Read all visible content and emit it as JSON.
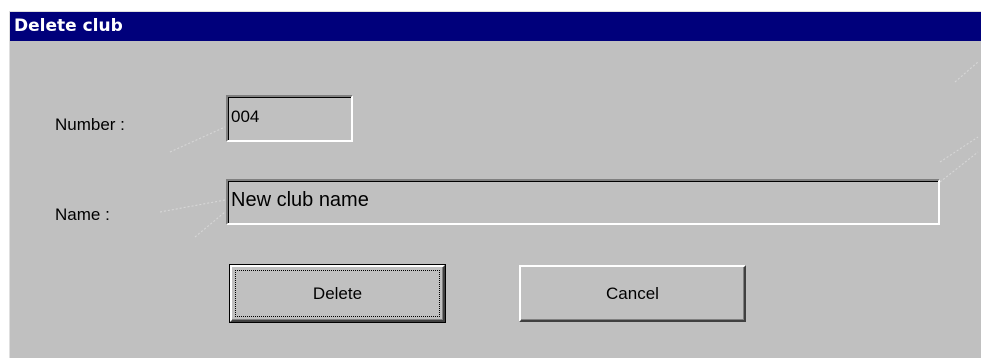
{
  "window": {
    "title": "Delete club"
  },
  "form": {
    "number_label": "Number :",
    "number_value": "004",
    "name_label": "Name :",
    "name_value": "New club name"
  },
  "buttons": {
    "delete_label": "Delete",
    "cancel_label": "Cancel"
  },
  "colors": {
    "title_bar": "#00007b",
    "face": "#c0c0c0"
  }
}
